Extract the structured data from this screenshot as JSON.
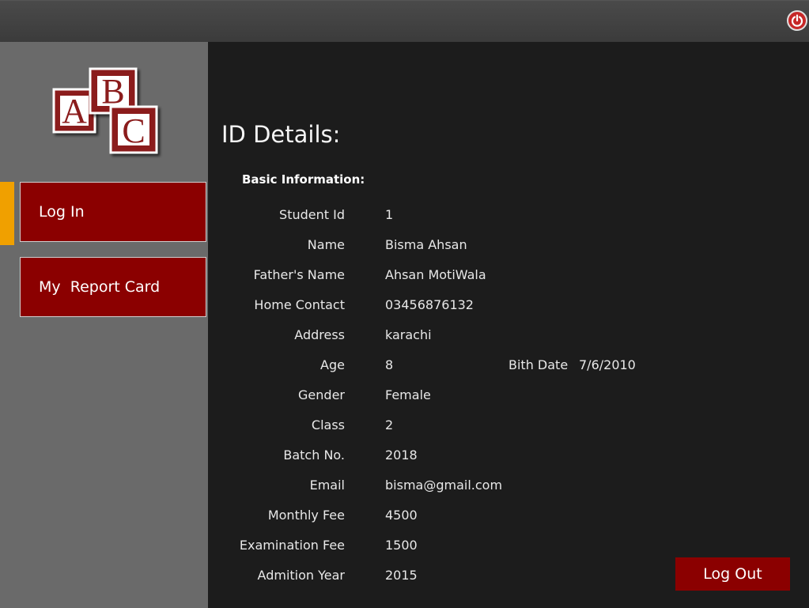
{
  "logo": {
    "letters": [
      "A",
      "B",
      "C"
    ]
  },
  "colors": {
    "accent": "#f0a000",
    "button": "#8b0000",
    "sidebar": "#6a6a6a",
    "panel": "#1c1c1c"
  },
  "icons": {
    "power": "power-icon"
  },
  "sidebar": {
    "items": [
      {
        "label": "Log In"
      },
      {
        "label": "My  Report Card"
      }
    ]
  },
  "main": {
    "title": "ID Details:",
    "subtitle": "Basic Information:",
    "fields": [
      {
        "label": "Student Id",
        "value": "1"
      },
      {
        "label": "Name",
        "value": "Bisma Ahsan"
      },
      {
        "label": "Father's Name",
        "value": "Ahsan MotiWala"
      },
      {
        "label": "Home Contact",
        "value": "03456876132"
      },
      {
        "label": "Address",
        "value": "karachi"
      },
      {
        "label": "Age",
        "value": "8"
      },
      {
        "label": "Gender",
        "value": "Female"
      },
      {
        "label": "Class",
        "value": "2"
      },
      {
        "label": "Batch No.",
        "value": "2018"
      },
      {
        "label": "Email",
        "value": "bisma@gmail.com"
      },
      {
        "label": "Monthly Fee",
        "value": "4500"
      },
      {
        "label": "Examination Fee",
        "value": "1500"
      },
      {
        "label": "Admition Year",
        "value": "2015"
      }
    ],
    "birth_date": {
      "label": "Bith Date",
      "value": "7/6/2010"
    },
    "logout_label": "Log Out"
  }
}
